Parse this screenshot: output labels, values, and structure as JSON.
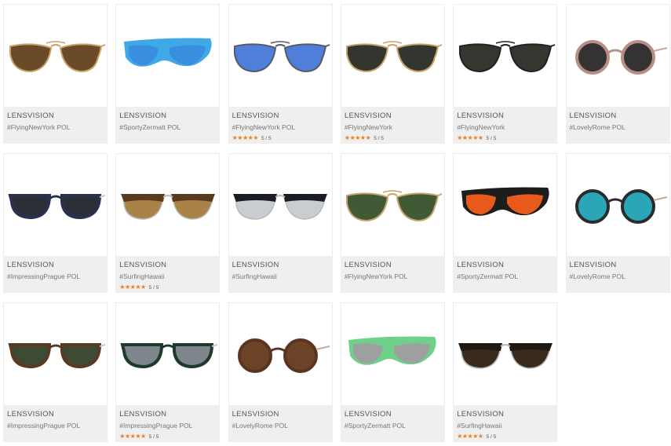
{
  "products": [
    {
      "brand": "LENSVISION",
      "model": "#FlyingNewYork POL",
      "rating": null,
      "style": "aviator",
      "lens": "#6b4a2a",
      "frame": "#c9a36a"
    },
    {
      "brand": "LENSVISION",
      "model": "#SportyZermatt POL",
      "rating": null,
      "style": "sport",
      "lens": "#3a8ee0",
      "frame": "#3fa9e8"
    },
    {
      "brand": "LENSVISION",
      "model": "#FlyingNewYork POL",
      "rating": {
        "stars": "★★★★★",
        "score": "5 / 5"
      },
      "style": "aviator",
      "lens": "#4f7fd8",
      "frame": "#555b66"
    },
    {
      "brand": "LENSVISION",
      "model": "#FlyingNewYork",
      "rating": {
        "stars": "★★★★★",
        "score": "5 / 5"
      },
      "style": "aviator",
      "lens": "#33352f",
      "frame": "#c9a36a"
    },
    {
      "brand": "LENSVISION",
      "model": "#FlyingNewYork",
      "rating": {
        "stars": "★★★★★",
        "score": "5 / 5"
      },
      "style": "aviator",
      "lens": "#34362f",
      "frame": "#222222"
    },
    {
      "brand": "LENSVISION",
      "model": "#LovelyRome POL",
      "rating": null,
      "style": "round",
      "lens": "#333333",
      "frame": "#b88e86"
    },
    {
      "brand": "LENSVISION",
      "model": "#ImpressingPrague POL",
      "rating": null,
      "style": "wayfarer",
      "lens": "#2c2f36",
      "frame": "#2a3150"
    },
    {
      "brand": "LENSVISION",
      "model": "#SurfingHawaii",
      "rating": {
        "stars": "★★★★★",
        "score": "5 / 5"
      },
      "style": "clubmaster",
      "lens": "#a88246",
      "frame": "#5a3a1f"
    },
    {
      "brand": "LENSVISION",
      "model": "#SurfingHawaii",
      "rating": null,
      "style": "clubmaster",
      "lens": "#c9ccd1",
      "frame": "#1a1c26"
    },
    {
      "brand": "LENSVISION",
      "model": "#FlyingNewYork POL",
      "rating": null,
      "style": "aviator",
      "lens": "#3f5a35",
      "frame": "#c9a36a"
    },
    {
      "brand": "LENSVISION",
      "model": "#SportyZermatt POL",
      "rating": null,
      "style": "sport",
      "lens": "#e85a1c",
      "frame": "#1d1d1d"
    },
    {
      "brand": "LENSVISION",
      "model": "#LovelyRome POL",
      "rating": null,
      "style": "round",
      "lens": "#2aa6b8",
      "frame": "#2b2b2b"
    },
    {
      "brand": "LENSVISION",
      "model": "#ImpressingPrague POL",
      "rating": null,
      "style": "wayfarer",
      "lens": "#3d4a34",
      "frame": "#5a3a22"
    },
    {
      "brand": "LENSVISION",
      "model": "#ImpressingPrague POL",
      "rating": {
        "stars": "★★★★★",
        "score": "5 / 5"
      },
      "style": "wayfarer",
      "lens": "#7f868c",
      "frame": "#1f3a2c"
    },
    {
      "brand": "LENSVISION",
      "model": "#LovelyRome POL",
      "rating": null,
      "style": "round",
      "lens": "#6b4326",
      "frame": "#5a3420"
    },
    {
      "brand": "LENSVISION",
      "model": "#SportyZermatt POL",
      "rating": null,
      "style": "sport",
      "lens": "#9ea0a0",
      "frame": "#6fd08a"
    },
    {
      "brand": "LENSVISION",
      "model": "#SurfingHawaii",
      "rating": {
        "stars": "★★★★★",
        "score": "5 / 5"
      },
      "style": "clubmaster",
      "lens": "#3a2a1c",
      "frame": "#1f1712"
    }
  ]
}
